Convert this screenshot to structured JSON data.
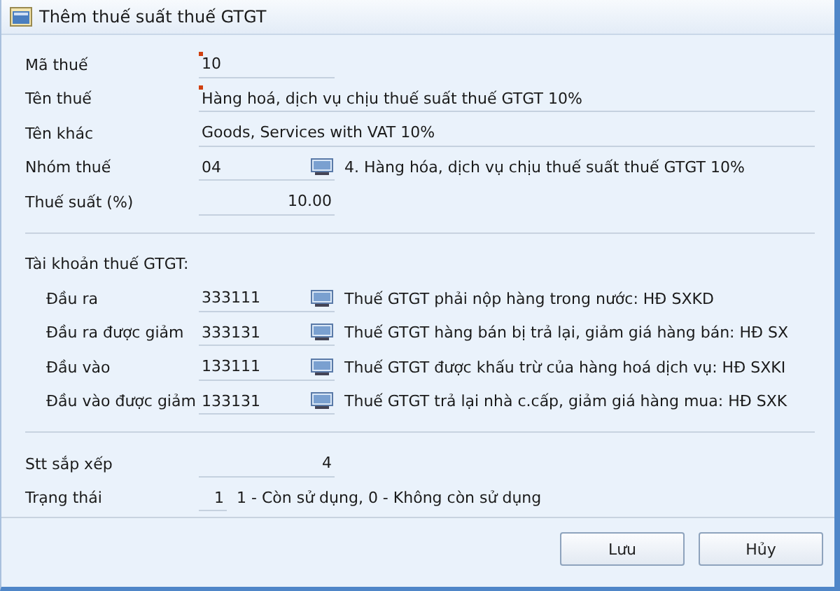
{
  "window": {
    "title": "Thêm thuế suất thuế GTGT"
  },
  "fields": [
    {
      "label": "Mã thuế",
      "value": "10",
      "kind": "short",
      "required": true
    },
    {
      "label": "Tên thuế",
      "value": "Hàng hoá, dịch vụ chịu thuế suất thuế GTGT 10%",
      "kind": "wide",
      "required": true
    },
    {
      "label": "Tên khác",
      "value": "Goods, Services with VAT 10%",
      "kind": "wide",
      "required": false
    },
    {
      "label": "Nhóm thuế",
      "value": "04",
      "kind": "lookup",
      "required": false,
      "description": "4. Hàng hóa, dịch vụ chịu thuế suất thuế GTGT 10%"
    },
    {
      "label": "Thuế suất (%)",
      "value": "10.00",
      "kind": "number",
      "required": false
    }
  ],
  "accounts": {
    "heading": "Tài khoản thuế GTGT:",
    "rows": [
      {
        "label": "Đầu ra",
        "value": "333111",
        "description": "Thuế GTGT phải nộp hàng trong nước: HĐ SXKD"
      },
      {
        "label": "Đầu ra được giảm",
        "value": "333131",
        "description": "Thuế GTGT hàng bán bị trả lại, giảm giá hàng bán: HĐ SX"
      },
      {
        "label": "Đầu vào",
        "value": "133111",
        "description": "Thuế GTGT được khấu trừ của hàng hoá dịch vụ: HĐ SXKI"
      },
      {
        "label": "Đầu vào được giảm",
        "value": "133131",
        "description": "Thuế GTGT trả lại nhà c.cấp, giảm giá hàng mua: HĐ SXK"
      }
    ]
  },
  "footer_fields": [
    {
      "label": "Stt sắp xếp",
      "value": "4",
      "kind": "number"
    },
    {
      "label": "Trạng thái",
      "value": "1",
      "kind": "tiny",
      "description": "1 - Còn sử dụng, 0 - Không còn sử dụng"
    }
  ],
  "buttons": [
    "Lưu",
    "Hủy"
  ]
}
